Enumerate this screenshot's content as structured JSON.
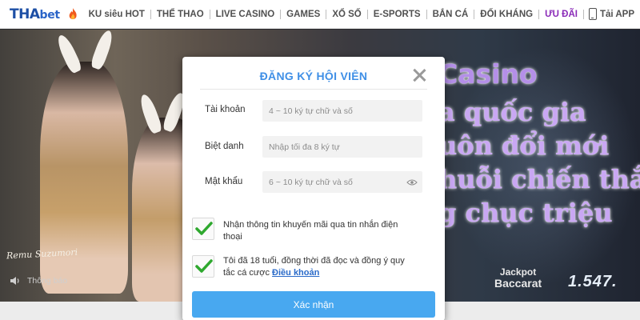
{
  "nav": {
    "logo_part1": "THA",
    "logo_part2": "bet",
    "items": [
      "KU siêu HOT",
      "THỂ THAO",
      "LIVE CASINO",
      "GAMES",
      "XỔ SỐ",
      "E-SPORTS",
      "BẮN CÁ",
      "ĐỐI KHÁNG",
      "ƯU ĐÃI",
      "Tải APP"
    ],
    "promo_color": "#8a2bb8"
  },
  "hero": {
    "name_text": "Remu Suzumori",
    "notice_label": "Thông báo",
    "promo_lines": [
      "Casino",
      "a quốc gia",
      "uôn đổi mới",
      "huỗi chiến thắ",
      "g chục triệu"
    ],
    "jackpot_label_1": "Jackpot",
    "jackpot_label_2": "Baccarat",
    "jackpot_value": "1.547."
  },
  "modal": {
    "title": "ĐĂNG KÝ HỘI VIÊN",
    "fields": [
      {
        "label": "Tài khoản",
        "placeholder": "4 ~ 10 ký tự chữ và số"
      },
      {
        "label": "Biệt danh",
        "placeholder": "Nhập tối đa 8 ký tự"
      },
      {
        "label": "Mật khẩu",
        "placeholder": "6 ~ 10 ký tự chữ và số"
      }
    ],
    "checks": [
      {
        "text": "Nhận thông tin khuyến mãi qua tin nhắn điện thoại",
        "checked": true
      },
      {
        "text": "Tôi đã 18 tuổi, đồng thời đã đọc và đồng ý quy tắc cá cược",
        "link": "Điều khoản",
        "checked": true
      }
    ],
    "submit_label": "Xác nhận",
    "accent_color": "#3f8fe6",
    "check_color": "#2ea82e"
  },
  "icons": [
    "fire-icon",
    "phone-icon",
    "close-icon",
    "eye-icon",
    "check-icon",
    "speaker-icon"
  ]
}
